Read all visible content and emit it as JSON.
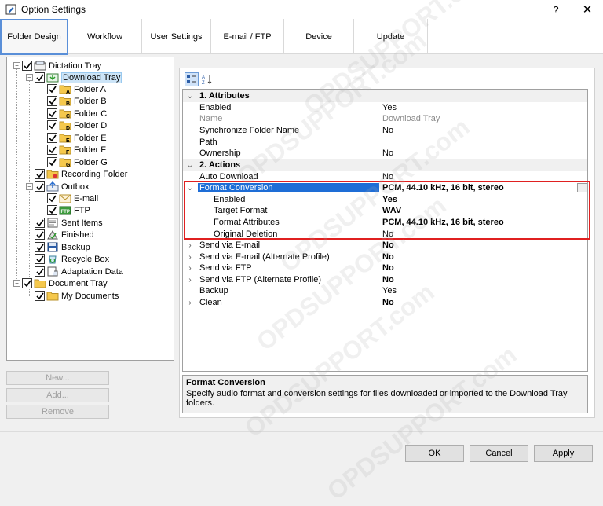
{
  "window": {
    "title": "Option Settings",
    "help": "?",
    "close": "✕"
  },
  "tabs": [
    {
      "label": "Folder Design",
      "active": true
    },
    {
      "label": "Workflow"
    },
    {
      "label": "User Settings"
    },
    {
      "label": "E-mail / FTP"
    },
    {
      "label": "Device"
    },
    {
      "label": "Update"
    }
  ],
  "tree": {
    "dictation_tray": "Dictation Tray",
    "download_tray": "Download Tray",
    "folder_a": "Folder A",
    "folder_b": "Folder B",
    "folder_c": "Folder C",
    "folder_d": "Folder D",
    "folder_e": "Folder E",
    "folder_f": "Folder F",
    "folder_g": "Folder G",
    "recording_folder": "Recording Folder",
    "outbox": "Outbox",
    "email": "E-mail",
    "ftp": "FTP",
    "sent_items": "Sent Items",
    "finished": "Finished",
    "backup": "Backup",
    "recycle_box": "Recycle Box",
    "adaptation_data": "Adaptation Data",
    "document_tray": "Document Tray",
    "my_documents": "My Documents"
  },
  "left_buttons": {
    "new": "New...",
    "add": "Add...",
    "remove": "Remove"
  },
  "properties": {
    "cat1": "1. Attributes",
    "enabled": {
      "name": "Enabled",
      "value": "Yes"
    },
    "name": {
      "name": "Name",
      "value": "Download Tray"
    },
    "sync": {
      "name": "Synchronize Folder Name",
      "value": "No"
    },
    "path": {
      "name": "Path",
      "value": ""
    },
    "ownership": {
      "name": "Ownership",
      "value": "No"
    },
    "cat2": "2. Actions",
    "auto_download": {
      "name": "Auto Download",
      "value": "No"
    },
    "format_conversion": {
      "name": "Format Conversion",
      "value": "PCM, 44.10 kHz, 16 bit, stereo",
      "button": "..."
    },
    "fc_enabled": {
      "name": "Enabled",
      "value": "Yes"
    },
    "fc_target": {
      "name": "Target Format",
      "value": "WAV"
    },
    "fc_attr": {
      "name": "Format Attributes",
      "value": "PCM, 44.10 kHz, 16 bit, stereo"
    },
    "fc_delete": {
      "name": "Original Deletion",
      "value": "No"
    },
    "send_email": {
      "name": "Send via E-mail",
      "value": "No"
    },
    "send_email_alt": {
      "name": "Send via E-mail (Alternate Profile)",
      "value": "No"
    },
    "send_ftp": {
      "name": "Send via FTP",
      "value": "No"
    },
    "send_ftp_alt": {
      "name": "Send via FTP (Alternate Profile)",
      "value": "No"
    },
    "backup": {
      "name": "Backup",
      "value": "Yes"
    },
    "clean": {
      "name": "Clean",
      "value": "No"
    }
  },
  "description": {
    "title": "Format Conversion",
    "text": "Specify audio format and conversion settings for files downloaded or imported to the Download Tray folders."
  },
  "buttons": {
    "ok": "OK",
    "cancel": "Cancel",
    "apply": "Apply"
  },
  "watermark": "OPDSUPPORT.com",
  "colors": {
    "accent": "#1e6dd6",
    "highlight_box": "#e02020",
    "tab_active_border": "#5a8fd8"
  }
}
